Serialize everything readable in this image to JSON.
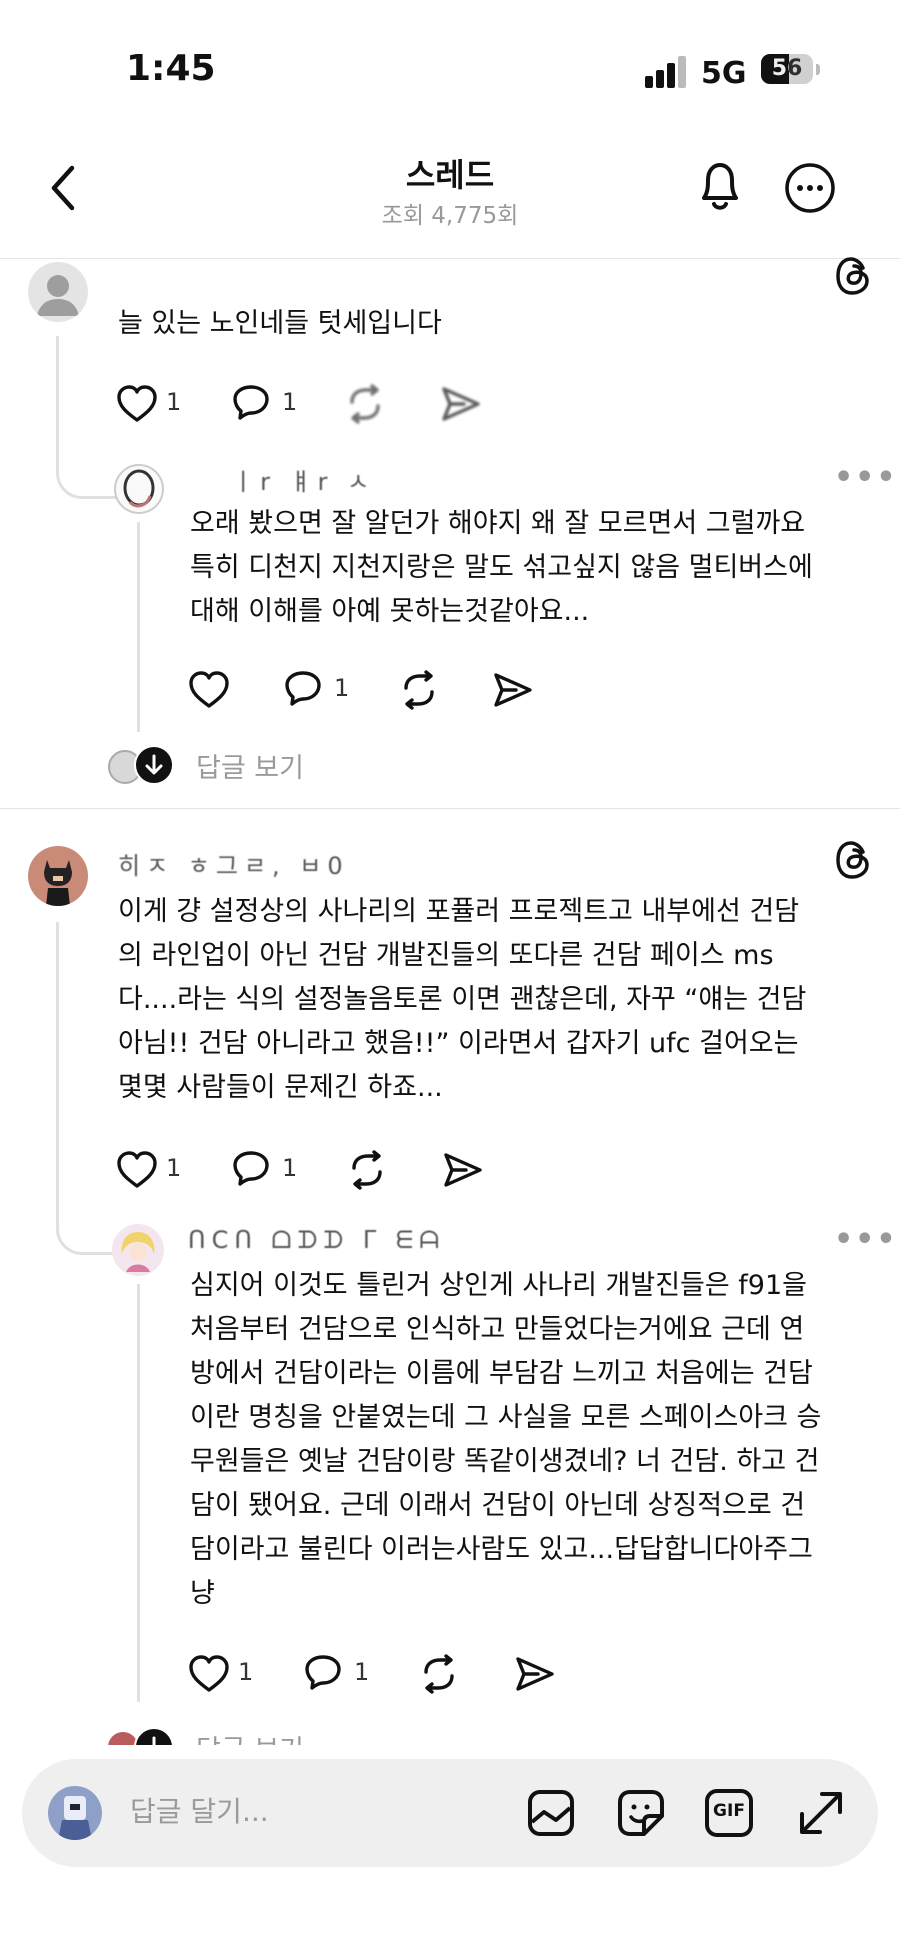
{
  "status_bar": {
    "time": "1:45",
    "network": "5G",
    "battery": "56"
  },
  "header": {
    "title": "스레드",
    "views": "조회 4,775회"
  },
  "posts": [
    {
      "text": "늘 있는 노인네들 텃세입니다",
      "likes": "1",
      "replies": "1",
      "reply": {
        "username": "ㅣr    ㅒr ㅅ",
        "text": "오래 봤으면 잘 알던가 해야지 왜 잘 모르면서 그럴까요\n특히 디천지 지천지랑은 말도 섞고싶지 않음 멀티버스에\n대해 이해를 아예 못하는것같아요...",
        "likes": "",
        "replies": "1",
        "view_replies": "답글 보기"
      }
    },
    {
      "username": "히ㅈ ㅎ그ㄹ, ㅂ0",
      "text": "이게 걍 설정상의 사나리의 포퓰러 프로젝트고 내부에선 건담\n의 라인업이 아닌 건담 개발진들의 또다른 건담 페이스 ms\n다....라는 식의 설정놀음토론 이면 괜찮은데, 자꾸 “얘는 건담\n아님!! 건담 아니라고 했음!!” 이라면서 갑자기 ufc 걸어오는\n몇몇 사람들이 문제긴 하죠...",
      "likes": "1",
      "replies": "1",
      "reply": {
        "username": "ᑎCᑎ ᗝᗪᗪ ᒥ ᗴᗩ",
        "text": "심지어 이것도 틀린거 상인게 사나리 개발진들은 f91을\n처음부터 건담으로 인식하고 만들었다는거에요 근데 연\n방에서 건담이라는 이름에 부담감 느끼고 처음에는 건담\n이란 명칭을 안붙였는데 그 사실을 모른 스페이스아크 승\n무원들은 옛날 건담이랑 똑같이생겼네? 너 건담. 하고 건\n담이 됐어요. 근데 이래서 건담이 아닌데 상징적으로 건\n담이라고 불린다 이러는사람도 있고...답답합니다아주그\n냥",
        "likes": "1",
        "replies": "1",
        "view_replies": "답글 보기"
      }
    }
  ],
  "composer": {
    "placeholder": "답글 달기...",
    "gif_label": "GIF"
  },
  "colors": {
    "text": "#111111",
    "muted": "#999999",
    "composer_bg": "#efefef",
    "divider": "#e5e5e5"
  },
  "icons": [
    "back-arrow-icon",
    "bell-icon",
    "more-icon",
    "threads-logo-icon",
    "heart-icon",
    "comment-icon",
    "repost-icon",
    "share-icon",
    "image-icon",
    "sticker-icon",
    "gif-icon",
    "expand-icon"
  ]
}
